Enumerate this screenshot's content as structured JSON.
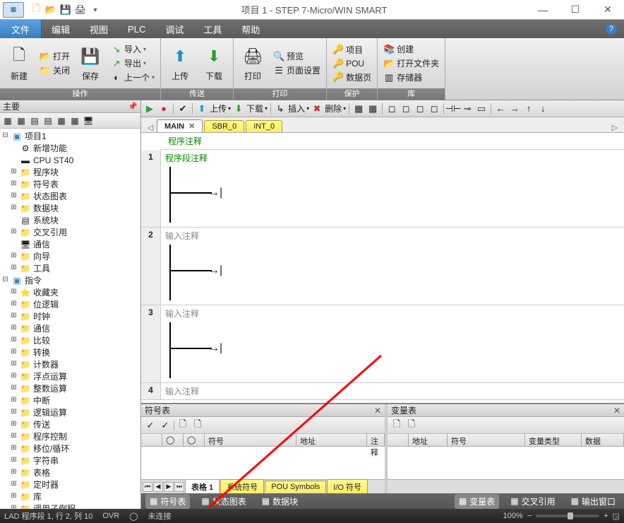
{
  "title": "项目 1 - STEP 7-Micro/WIN SMART",
  "menu": {
    "file": "文件",
    "edit": "编辑",
    "view": "视图",
    "plc": "PLC",
    "debug": "调试",
    "tool": "工具",
    "help": "帮助"
  },
  "ribbon": {
    "new": "新建",
    "open": "打开",
    "close": "关闭",
    "save": "保存",
    "import": "导入",
    "export": "导出",
    "prev": "上一个",
    "upload": "上传",
    "download": "下载",
    "print": "打印",
    "preview": "预览",
    "pagesetup": "页面设置",
    "project": "项目",
    "pou": "POU",
    "datapage": "数据页",
    "create": "创建",
    "openfolder": "打开文件夹",
    "storage": "存储器",
    "g_ops": "操作",
    "g_transfer": "传送",
    "g_print": "打印",
    "g_protect": "保护",
    "g_lib": "库"
  },
  "editbar": {
    "upload": "上传",
    "download": "下载",
    "insert": "插入",
    "delete": "删除"
  },
  "tabs": {
    "main": "MAIN",
    "sbr": "SBR_0",
    "int": "INT_0"
  },
  "tree_title": "主要",
  "tree": {
    "project": "项目1",
    "newfeat": "新增功能",
    "cpu": "CPU ST40",
    "prgblock": "程序块",
    "symtable": "符号表",
    "statchart": "状态图表",
    "datablock": "数据块",
    "sysblock": "系统块",
    "xref": "交叉引用",
    "comm": "通信",
    "wizard": "向导",
    "tools": "工具",
    "instr": "指令",
    "fav": "收藏夹",
    "bitlogic": "位逻辑",
    "clock": "时钟",
    "commI": "通信",
    "compare": "比较",
    "convert": "转换",
    "counter": "计数器",
    "float": "浮点运算",
    "int": "整数运算",
    "interrupt": "中断",
    "logic": "逻辑运算",
    "transfer": "传送",
    "progctrl": "程序控制",
    "shift": "移位/循环",
    "string": "字符串",
    "table": "表格",
    "timer": "定时器",
    "lib": "库",
    "subr": "调用子例程"
  },
  "ladder": {
    "progcomment": "程序注释",
    "netcomment": "程序段注释",
    "inputcomment": "输入注释"
  },
  "symtab": {
    "title": "符号表",
    "cols": {
      "sym": "符号",
      "addr": "地址",
      "comm": "注释"
    },
    "tabs": {
      "t1": "表格 1",
      "t2": "系统符号",
      "t3": "POU Symbols",
      "t4": "I/O 符号"
    }
  },
  "vartab": {
    "title": "变量表",
    "cols": {
      "addr": "地址",
      "sym": "符号",
      "type": "变量类型",
      "data": "数据"
    }
  },
  "bottabs": {
    "sym": "符号表",
    "stat": "状态图表",
    "data": "数据块",
    "var": "变量表",
    "xref": "交叉引用",
    "out": "输出窗口"
  },
  "status": {
    "pos": "LAD 程序段 1, 行 2, 列 10",
    "ovr": "OVR",
    "conn": "未连接",
    "zoom": "100%"
  }
}
